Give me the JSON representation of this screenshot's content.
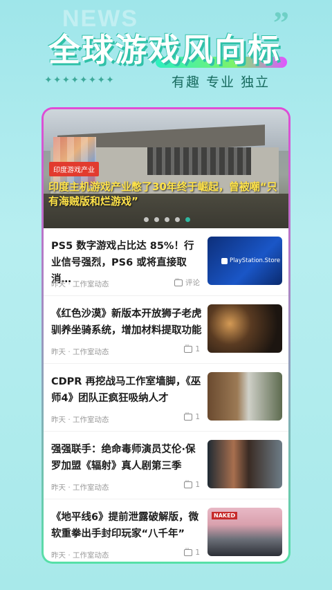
{
  "header": {
    "bg_word": "NEWS",
    "title": "全球游戏风向标",
    "sparkles": "✦✦✦✦✦✦✦✦",
    "tagline": "有趣  专业  独立",
    "quote_glyph": "”"
  },
  "banner": {
    "tag": "印度游戏产业",
    "title": "印度主机游戏产业憋了30年终于崛起，曾被嘲“只有海贼版和烂游戏”",
    "dots_total": 5,
    "active_dot_index": 4
  },
  "news": [
    {
      "title": "PS5 数字游戏占比达 85%！行业信号强烈，PS6 或将直接取消…",
      "meta": "昨天 · 工作室动态",
      "comment": "评论",
      "thumb_text": "PlayStation.Store"
    },
    {
      "title": "《红色沙漠》新版本开放狮子老虎驯养坐骑系统，增加材料提取功能",
      "meta": "昨天 · 工作室动态",
      "comment": "1"
    },
    {
      "title": "CDPR 再挖战马工作室墙脚，《巫师4》团队正疯狂吸纳人才",
      "meta": "昨天 · 工作室动态",
      "comment": "1"
    },
    {
      "title": "强强联手：绝命毒师演员艾伦·保罗加盟《辐射》真人剧第三季",
      "meta": "昨天 · 工作室动态",
      "comment": "1"
    },
    {
      "title": "《地平线6》提前泄露破解版，微软重拳出手封印玩家“八千年”",
      "meta": "昨天 · 工作室动态",
      "comment": "1",
      "thumb_text": "NAKED"
    }
  ],
  "colors": {
    "accent": "#2fb7a0",
    "banner_title": "#ffe34a",
    "tag_red": "#e23b2e"
  }
}
